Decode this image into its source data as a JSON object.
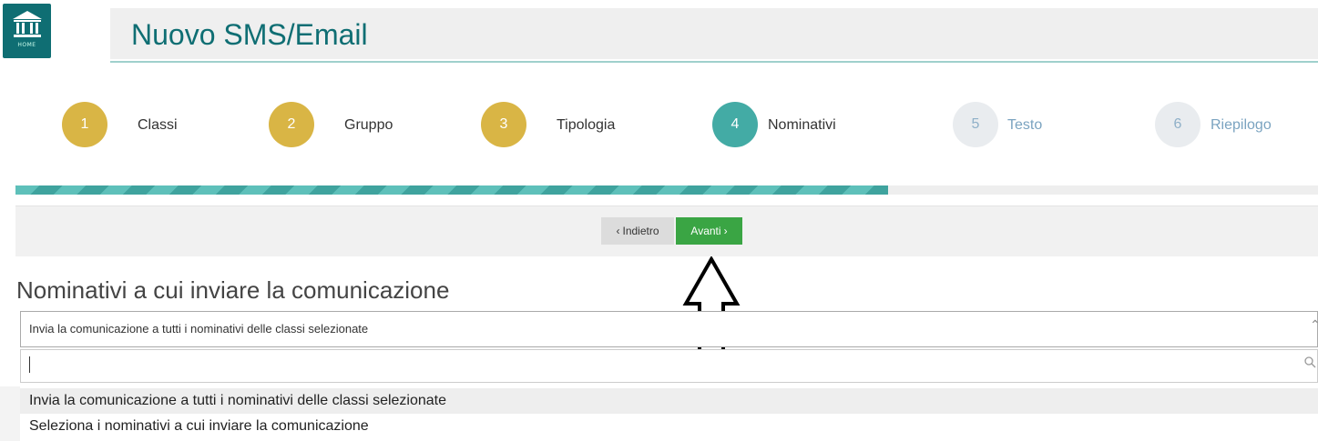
{
  "header": {
    "home_label": "HOME",
    "title": "Nuovo SMS/Email"
  },
  "steps": [
    {
      "number": "1",
      "label": "Classi",
      "state": "done"
    },
    {
      "number": "2",
      "label": "Gruppo",
      "state": "done"
    },
    {
      "number": "3",
      "label": "Tipologia",
      "state": "done"
    },
    {
      "number": "4",
      "label": "Nominativi",
      "state": "active"
    },
    {
      "number": "5",
      "label": "Testo",
      "state": "pending"
    },
    {
      "number": "6",
      "label": "Riepilogo",
      "state": "pending"
    }
  ],
  "progress": {
    "fraction": 0.67
  },
  "nav": {
    "back_label": "Indietro",
    "next_label": "Avanti"
  },
  "section": {
    "title": "Nominativi a cui inviare la comunicazione",
    "selected_value": "Invia la comunicazione a tutti i nominativi delle classi selezionate",
    "search_value": "",
    "options": [
      "Invia la comunicazione a tutti i nominativi delle classi selezionate",
      "Seleziona i nominativi a cui inviare la comunicazione"
    ]
  },
  "icons": {
    "home": "bank-building-icon",
    "search": "search-icon",
    "caret": "chevron-up-icon",
    "annotation": "arrow-up-outline-icon"
  },
  "colors": {
    "brand": "#0f6e73",
    "step_done": "#d9b545",
    "step_active": "#43aba5",
    "step_pending": "#e9ecef",
    "next_button": "#3aa544",
    "back_button": "#dcdcdc"
  }
}
